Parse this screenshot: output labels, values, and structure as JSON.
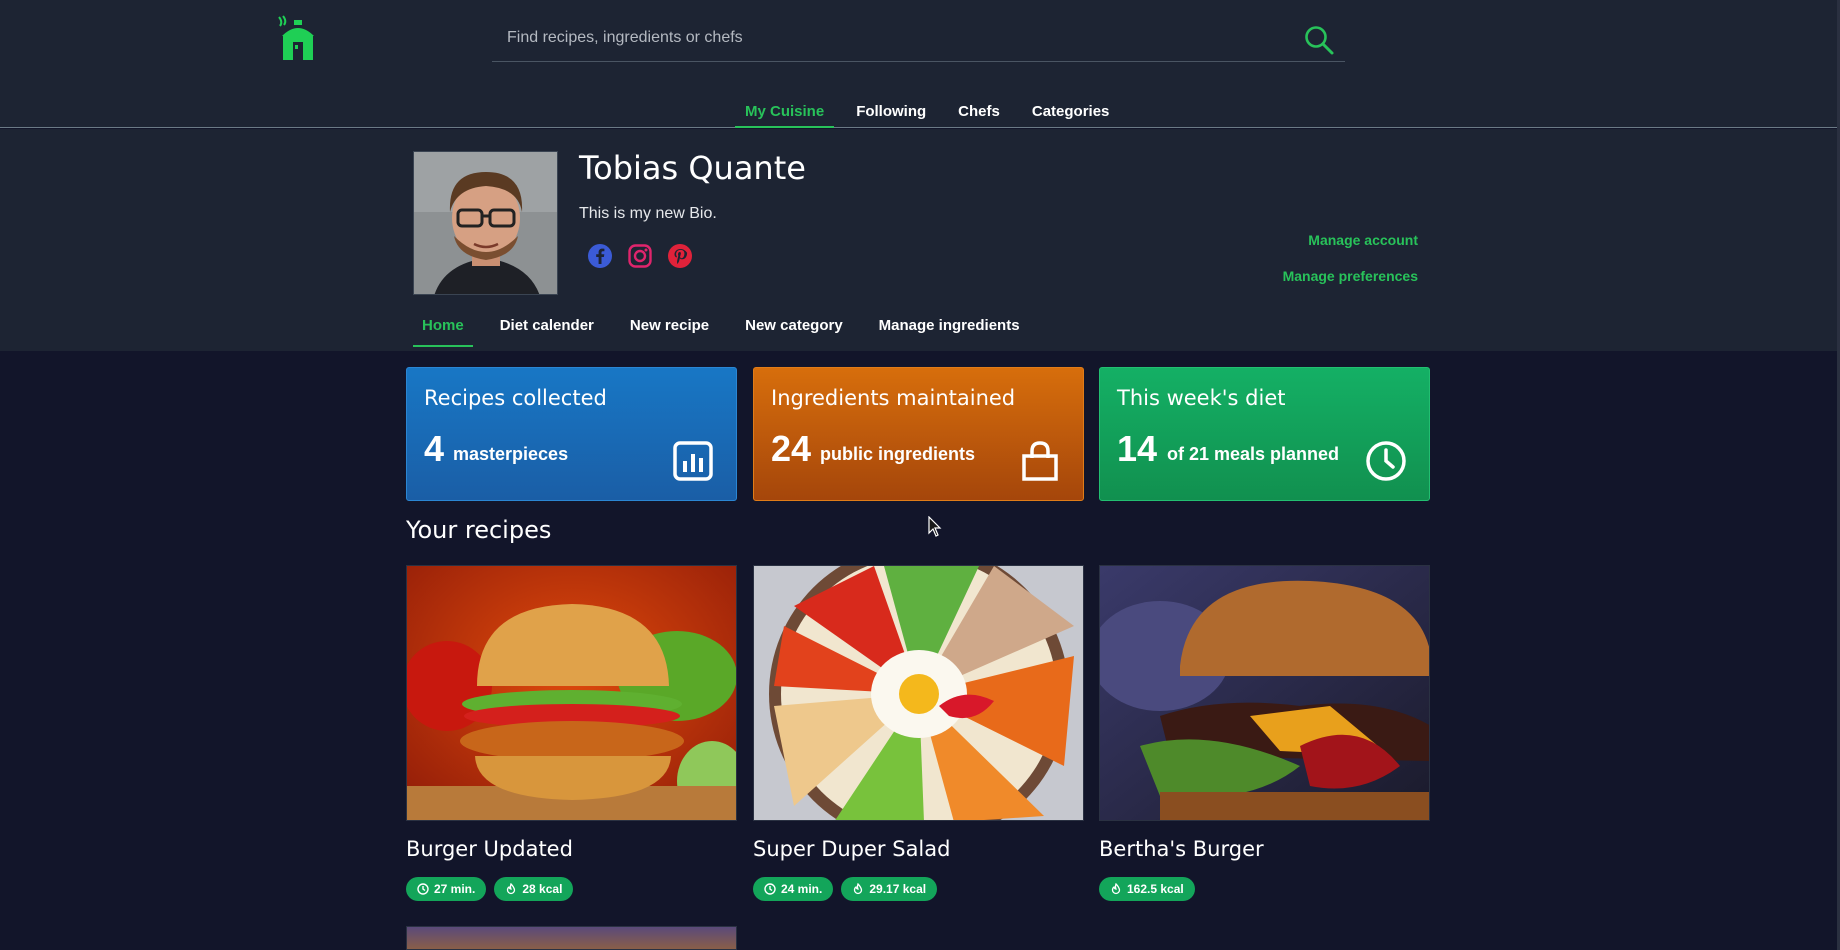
{
  "search": {
    "placeholder": "Find recipes, ingredients or chefs"
  },
  "main_nav": {
    "items": [
      "My Cuisine",
      "Following",
      "Chefs",
      "Categories"
    ],
    "active": "My Cuisine"
  },
  "profile": {
    "name": "Tobias Quante",
    "bio": "This is my new Bio.",
    "socials": [
      "facebook-icon",
      "instagram-icon",
      "pinterest-icon"
    ],
    "manage_account": "Manage account",
    "manage_preferences": "Manage preferences"
  },
  "sub_nav": {
    "items": [
      "Home",
      "Diet calender",
      "New recipe",
      "New category",
      "Manage ingredients"
    ],
    "active": "Home"
  },
  "stats": [
    {
      "title": "Recipes collected",
      "value": "4",
      "unit": "masterpieces",
      "icon": "bar-chart-icon",
      "color": "#1877c5"
    },
    {
      "title": "Ingredients maintained",
      "value": "24",
      "unit": "public ingredients",
      "icon": "shopping-bag-icon",
      "color": "#d76e0c"
    },
    {
      "title": "This week's diet",
      "value": "14",
      "unit": "of 21 meals planned",
      "icon": "clock-icon",
      "color": "#14b065"
    }
  ],
  "recipes_section": {
    "title": "Your recipes"
  },
  "recipes": [
    {
      "title": "Burger Updated",
      "time": "27 min.",
      "kcal": "28 kcal"
    },
    {
      "title": "Super Duper Salad",
      "time": "24 min.",
      "kcal": "29.17 kcal"
    },
    {
      "title": "Bertha's Burger",
      "kcal": "162.5 kcal"
    }
  ],
  "colors": {
    "accent": "#28c25a",
    "header_bg": "#1d2433",
    "page_bg": "#12152a",
    "badge": "#13a55a"
  }
}
